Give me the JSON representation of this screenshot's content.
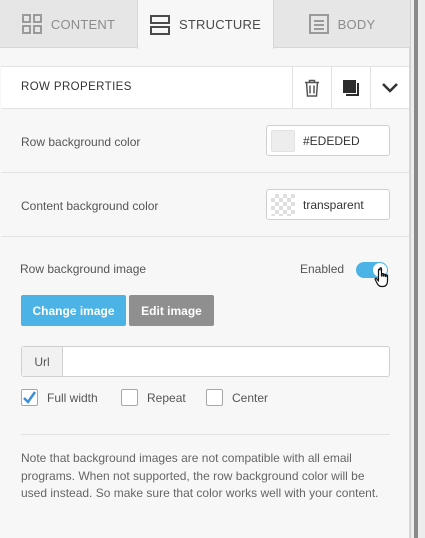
{
  "tabs": [
    {
      "label": "CONTENT",
      "icon": "grid-icon"
    },
    {
      "label": "STRUCTURE",
      "icon": "rows-icon",
      "active": true
    },
    {
      "label": "BODY",
      "icon": "document-icon"
    }
  ],
  "row_properties": {
    "title": "ROW PROPERTIES",
    "actions": [
      "trash-icon",
      "copy-icon",
      "chevron-down-icon"
    ]
  },
  "row_bg_color": {
    "label": "Row background color",
    "value": "#EDEDED",
    "swatch": "#ededed"
  },
  "content_bg_color": {
    "label": "Content background color",
    "value": "transparent"
  },
  "bg_image": {
    "label": "Row background image",
    "toggle_label": "Enabled",
    "enabled": true,
    "change_label": "Change image",
    "edit_label": "Edit image",
    "url_label": "Url",
    "url_value": "",
    "options": {
      "full_width": {
        "label": "Full width",
        "checked": true
      },
      "repeat": {
        "label": "Repeat",
        "checked": false
      },
      "center": {
        "label": "Center",
        "checked": false
      }
    }
  },
  "note": "Note that background images are not compatible with all email programs. When not supported, the row background color will be used instead. So make sure that color works well with your content.",
  "colors": {
    "accent": "#4cb3e6",
    "secondary_button": "#8f8f8f",
    "check": "#3a8fd8"
  }
}
